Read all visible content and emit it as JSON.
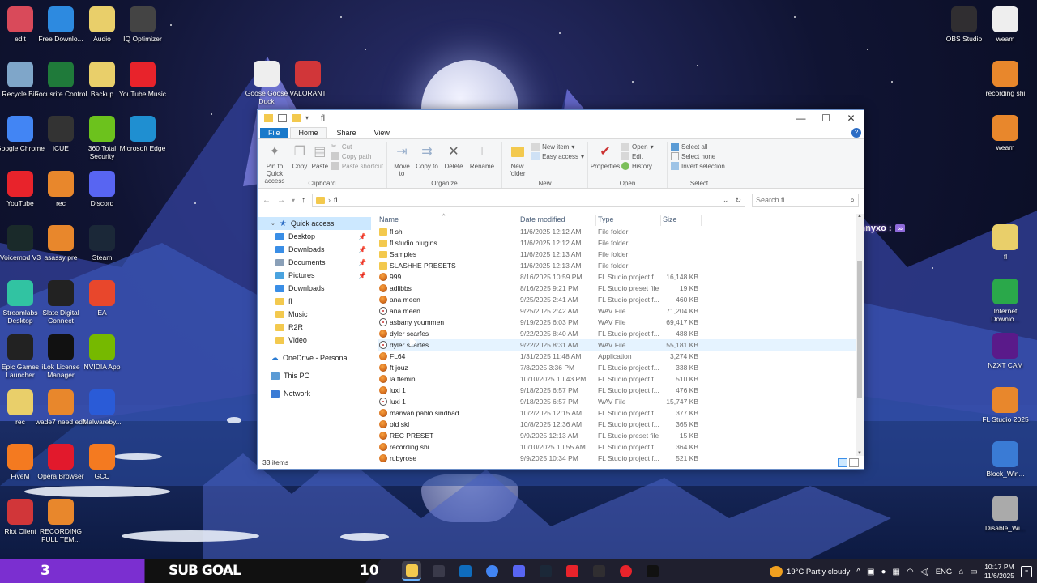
{
  "desktop_left": [
    {
      "label": "edit",
      "icon": "photo-icon",
      "color": "#d94a5a"
    },
    {
      "label": "Free Downlo...",
      "icon": "download-icon",
      "color": "#2d8ae0"
    },
    {
      "label": "Audio",
      "icon": "zip-folder-icon",
      "color": "#e9cf6a"
    },
    {
      "label": "IQ Optimizer",
      "icon": "iq-icon",
      "color": "#444"
    },
    {
      "label": "Recycle Bin",
      "icon": "recycle-bin-icon",
      "color": "#7fa6c9"
    },
    {
      "label": "Focusrite Control",
      "icon": "focusrite-icon",
      "color": "#1f7a3a"
    },
    {
      "label": "Backup",
      "icon": "zip-folder-icon",
      "color": "#e9cf6a"
    },
    {
      "label": "YouTube Music",
      "icon": "youtube-music-icon",
      "color": "#e8232b"
    },
    {
      "label": "Google Chrome",
      "icon": "chrome-icon",
      "color": "#4285f4"
    },
    {
      "label": "iCUE",
      "icon": "icue-icon",
      "color": "#333"
    },
    {
      "label": "360 Total Security",
      "icon": "security-icon",
      "color": "#6cc21d"
    },
    {
      "label": "Microsoft Edge",
      "icon": "edge-icon",
      "color": "#1f8fd1"
    },
    {
      "label": "YouTube",
      "icon": "youtube-icon",
      "color": "#e8232b"
    },
    {
      "label": "rec",
      "icon": "fl-studio-icon",
      "color": "#e8872c"
    },
    {
      "label": "Discord",
      "icon": "discord-icon",
      "color": "#5865f2"
    },
    {
      "label": "Voicemod V3",
      "icon": "voicemod-icon",
      "color": "#1a2a2a"
    },
    {
      "label": "asassy pre",
      "icon": "fl-studio-icon",
      "color": "#e8872c"
    },
    {
      "label": "Steam",
      "icon": "steam-icon",
      "color": "#1b2838"
    },
    {
      "label": "Streamlabs Desktop",
      "icon": "streamlabs-icon",
      "color": "#31c3a2"
    },
    {
      "label": "Slate Digital Connect",
      "icon": "slate-icon",
      "color": "#222"
    },
    {
      "label": "EA",
      "icon": "ea-icon",
      "color": "#e8472c"
    },
    {
      "label": "Epic Games Launcher",
      "icon": "epic-icon",
      "color": "#222"
    },
    {
      "label": "iLok License Manager",
      "icon": "ilok-icon",
      "color": "#111"
    },
    {
      "label": "NVIDIA App",
      "icon": "nvidia-icon",
      "color": "#76b900"
    },
    {
      "label": "rec",
      "icon": "zip-folder-icon",
      "color": "#e9cf6a"
    },
    {
      "label": "wade7 need edit",
      "icon": "fl-studio-icon",
      "color": "#e8872c"
    },
    {
      "label": "Malwareby...",
      "icon": "malwarebytes-icon",
      "color": "#2a5bd7"
    },
    {
      "label": "FiveM",
      "icon": "fivem-icon",
      "color": "#f47a20"
    },
    {
      "label": "Opera Browser",
      "icon": "opera-icon",
      "color": "#e2192c"
    },
    {
      "label": "GCC",
      "icon": "gcc-icon",
      "color": "#f47a20"
    },
    {
      "label": "Riot Client",
      "icon": "riot-icon",
      "color": "#d13639"
    },
    {
      "label": "RECORDING FULL TEM...",
      "icon": "fl-studio-icon",
      "color": "#e8872c"
    }
  ],
  "desktop_mid": [
    {
      "label": "Goose Goose Duck",
      "icon": "goose-icon",
      "color": "#eee"
    },
    {
      "label": "VALORANT",
      "icon": "valorant-icon",
      "color": "#d13639"
    }
  ],
  "desktop_right": [
    {
      "label": "OBS Studio",
      "icon": "obs-icon",
      "color": "#302e31"
    },
    {
      "label": "weam",
      "icon": "video-file-icon",
      "color": "#eee"
    },
    {
      "label": "recording shi",
      "icon": "fl-studio-icon",
      "color": "#e8872c"
    },
    {
      "label": "weam",
      "icon": "fl-studio-icon",
      "color": "#e8872c"
    },
    {
      "label": "fl",
      "icon": "zip-folder-icon",
      "color": "#e9cf6a"
    },
    {
      "label": "Internet Downlo...",
      "icon": "idm-icon",
      "color": "#2aa84a"
    },
    {
      "label": "NZXT CAM",
      "icon": "nzxt-icon",
      "color": "#5a1a8a"
    },
    {
      "label": "FL Studio 2025",
      "icon": "fl-studio-icon",
      "color": "#e8872c"
    },
    {
      "label": "Block_Win...",
      "icon": "script-icon",
      "color": "#3a7bd5"
    },
    {
      "label": "Disable_Wi...",
      "icon": "script-icon",
      "color": "#aaa"
    }
  ],
  "overlay": {
    "user": "remnyxo :",
    "badge": "∞"
  },
  "explorer": {
    "title": "fl",
    "tabs": [
      "File",
      "Home",
      "Share",
      "View"
    ],
    "ribbon": {
      "clipboard": {
        "pin": "Pin to Quick access",
        "copy": "Copy",
        "paste": "Paste",
        "cut": "Cut",
        "copy_path": "Copy path",
        "paste_shortcut": "Paste shortcut",
        "name": "Clipboard"
      },
      "organize": {
        "move": "Move to",
        "copy_to": "Copy to",
        "delete": "Delete",
        "rename": "Rename",
        "name": "Organize"
      },
      "new": {
        "new_folder": "New folder",
        "new_item": "New item",
        "easy_access": "Easy access",
        "name": "New"
      },
      "open": {
        "properties": "Properties",
        "open": "Open",
        "edit": "Edit",
        "history": "History",
        "name": "Open"
      },
      "select": {
        "all": "Select all",
        "none": "Select none",
        "invert": "Invert selection",
        "name": "Select"
      }
    },
    "address": "fl",
    "search_placeholder": "Search fl",
    "nav": {
      "quick_access": "Quick access",
      "pinned": [
        "Desktop",
        "Downloads",
        "Documents",
        "Pictures"
      ],
      "recent": [
        "Downloads",
        "fl",
        "Music",
        "R2R",
        "Video"
      ],
      "onedrive": "OneDrive - Personal",
      "this_pc": "This PC",
      "network": "Network"
    },
    "columns": {
      "name": "Name",
      "date": "Date modified",
      "type": "Type",
      "size": "Size"
    },
    "files": [
      {
        "name": "fl shi",
        "date": "11/6/2025 12:12 AM",
        "type": "File folder",
        "size": "",
        "icon": "folder"
      },
      {
        "name": "fl studio plugins",
        "date": "11/6/2025 12:12 AM",
        "type": "File folder",
        "size": "",
        "icon": "folder"
      },
      {
        "name": "Samples",
        "date": "11/6/2025 12:13 AM",
        "type": "File folder",
        "size": "",
        "icon": "folder"
      },
      {
        "name": "SLASHHE PRESETS",
        "date": "11/6/2025 12:13 AM",
        "type": "File folder",
        "size": "",
        "icon": "folder"
      },
      {
        "name": "999",
        "date": "8/16/2025 10:59 PM",
        "type": "FL Studio project f...",
        "size": "16,148 KB",
        "icon": "flp"
      },
      {
        "name": "adlibbs",
        "date": "8/16/2025 9:21 PM",
        "type": "FL Studio preset file",
        "size": "19 KB",
        "icon": "flp"
      },
      {
        "name": "ana meen",
        "date": "9/25/2025 2:41 AM",
        "type": "FL Studio project f...",
        "size": "460 KB",
        "icon": "flp"
      },
      {
        "name": "ana meen",
        "date": "9/25/2025 2:42 AM",
        "type": "WAV File",
        "size": "71,204 KB",
        "icon": "wav"
      },
      {
        "name": "asbany yoummen",
        "date": "9/19/2025 6:03 PM",
        "type": "WAV File",
        "size": "69,417 KB",
        "icon": "wav"
      },
      {
        "name": "dyler scarfes",
        "date": "9/22/2025 8:40 AM",
        "type": "FL Studio project f...",
        "size": "488 KB",
        "icon": "flp"
      },
      {
        "name": "dyler scarfes",
        "date": "9/22/2025 8:31 AM",
        "type": "WAV File",
        "size": "55,181 KB",
        "icon": "wav"
      },
      {
        "name": "FL64",
        "date": "1/31/2025 11:48 AM",
        "type": "Application",
        "size": "3,274 KB",
        "icon": "app"
      },
      {
        "name": "ft jouz",
        "date": "7/8/2025 3:36 PM",
        "type": "FL Studio project f...",
        "size": "338 KB",
        "icon": "flp"
      },
      {
        "name": "la tlemini",
        "date": "10/10/2025 10:43 PM",
        "type": "FL Studio project f...",
        "size": "510 KB",
        "icon": "flp"
      },
      {
        "name": "luxi 1",
        "date": "9/18/2025 6:57 PM",
        "type": "FL Studio project f...",
        "size": "476 KB",
        "icon": "flp"
      },
      {
        "name": "luxi 1",
        "date": "9/18/2025 6:57 PM",
        "type": "WAV File",
        "size": "15,747 KB",
        "icon": "wav"
      },
      {
        "name": "marwan pablo sindbad",
        "date": "10/2/2025 12:15 AM",
        "type": "FL Studio project f...",
        "size": "377 KB",
        "icon": "flp"
      },
      {
        "name": "old skl",
        "date": "10/8/2025 12:36 AM",
        "type": "FL Studio project f...",
        "size": "365 KB",
        "icon": "flp"
      },
      {
        "name": "REC PRESET",
        "date": "9/9/2025 12:13 AM",
        "type": "FL Studio preset file",
        "size": "15 KB",
        "icon": "flp"
      },
      {
        "name": "recording shi",
        "date": "10/10/2025 10:55 AM",
        "type": "FL Studio project f...",
        "size": "364 KB",
        "icon": "flp"
      },
      {
        "name": "rubyrose",
        "date": "9/9/2025 10:34 PM",
        "type": "FL Studio project f...",
        "size": "521 KB",
        "icon": "flp"
      }
    ],
    "status": "33 items"
  },
  "taskbar": {
    "subgoal_count": "3",
    "subgoal_label": "SUB GOAL",
    "subgoal_target": "10",
    "apps": [
      "file-explorer-icon",
      "calculator-icon",
      "outlook-icon",
      "chrome-icon",
      "discord-icon",
      "steam-icon",
      "youtube-icon",
      "obs-icon",
      "youtube-music-icon",
      "capcut-icon"
    ],
    "weather": "19°C  Partly cloudy",
    "lang": "ENG",
    "time": "10:17 PM",
    "date": "11/6/2025"
  }
}
